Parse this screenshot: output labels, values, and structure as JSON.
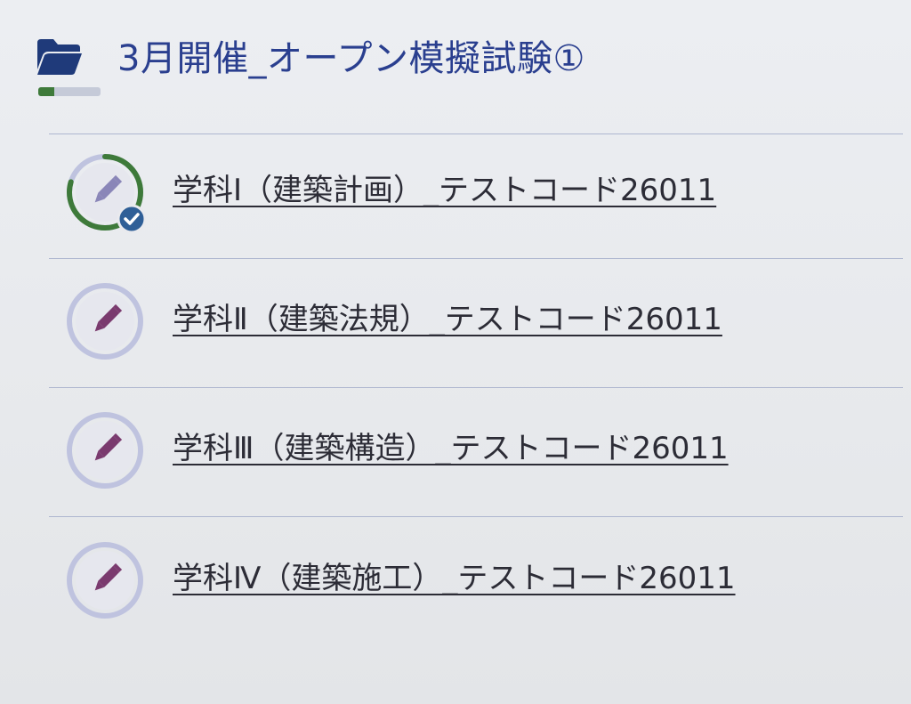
{
  "header": {
    "title": "3月開催_オープン模擬試験①",
    "icon": "folder-open-icon",
    "progress": 0.25,
    "accent": "#2a3f8f",
    "progress_color": "#3e7a3a"
  },
  "activities": [
    {
      "label": "学科Ⅰ（建築計画）_テストコード26011",
      "icon": "pencil-icon",
      "completed": true
    },
    {
      "label": "学科Ⅱ（建築法規）_テストコード26011",
      "icon": "pencil-icon",
      "completed": false
    },
    {
      "label": "学科Ⅲ（建築構造）_テストコード26011",
      "icon": "pencil-icon",
      "completed": false
    },
    {
      "label": "学科Ⅳ（建築施工）_テストコード26011",
      "icon": "pencil-icon",
      "completed": false
    }
  ],
  "colors": {
    "pencil": "#7a3a6e",
    "pencil_done": "#8a86b8",
    "ring": "#bfc3df",
    "ring_done": "#3e7a3a",
    "check_badge": "#2f5f97"
  }
}
